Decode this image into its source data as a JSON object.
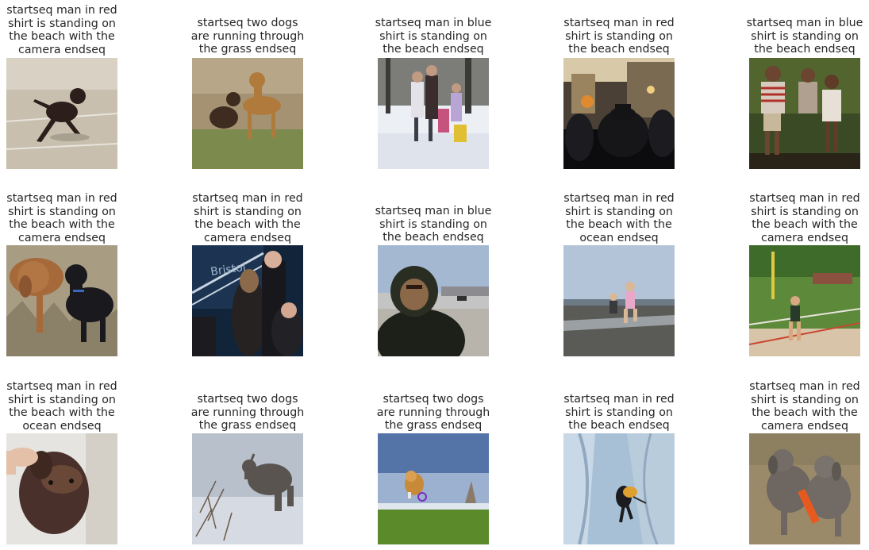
{
  "figure": {
    "rows": [
      {
        "cells": [
          {
            "caption": "startseq man in red\nshirt is standing on\nthe beach with the\ncamera endseq",
            "image": "dog-running-dirt-field"
          },
          {
            "caption": "startseq two dogs\nare running through\nthe grass endseq",
            "image": "two-dogs-on-grass"
          },
          {
            "caption": "startseq man in blue\nshirt is standing on\nthe beach endseq",
            "image": "family-in-snow"
          },
          {
            "caption": "startseq man in red\nshirt is standing on\nthe beach endseq",
            "image": "street-crowd-blurred"
          },
          {
            "caption": "startseq man in blue\nshirt is standing on\nthe beach endseq",
            "image": "children-posing-outdoors"
          }
        ]
      },
      {
        "cells": [
          {
            "caption": "startseq man in red\nshirt is standing on\nthe beach with the\ncamera endseq",
            "image": "two-dogs-in-dry-grass"
          },
          {
            "caption": "startseq man in red\nshirt is standing on\nthe beach with the\ncamera endseq",
            "image": "people-at-bristol-event"
          },
          {
            "caption": "startseq man in blue\nshirt is standing on\nthe beach endseq",
            "image": "man-in-hood-outdoors"
          },
          {
            "caption": "startseq man in red\nshirt is standing on\nthe beach with the\nocean endseq",
            "image": "kids-running-on-beach"
          },
          {
            "caption": "startseq man in red\nshirt is standing on\nthe beach with the\ncamera endseq",
            "image": "child-at-playground"
          }
        ]
      },
      {
        "cells": [
          {
            "caption": "startseq man in red\nshirt is standing on\nthe beach with the\nocean endseq",
            "image": "dog-closeup-with-hand"
          },
          {
            "caption": "startseq two dogs\nare running through\nthe grass endseq",
            "image": "dog-in-snow"
          },
          {
            "caption": "startseq two dogs\nare running through\nthe grass endseq",
            "image": "dog-jumping-for-frisbee"
          },
          {
            "caption": "startseq man in red\nshirt is standing on\nthe beach endseq",
            "image": "ice-climber"
          },
          {
            "caption": "startseq man in red\nshirt is standing on\nthe beach with the\ncamera endseq",
            "image": "two-weimaraners-with-toy"
          }
        ]
      }
    ]
  }
}
